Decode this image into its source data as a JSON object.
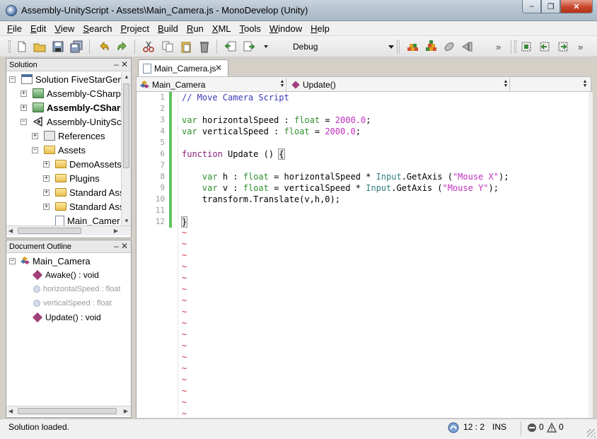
{
  "window": {
    "title": "Assembly-UnityScript - Assets\\Main_Camera.js - MonoDevelop (Unity)",
    "buttons": {
      "minimize": "‒",
      "maximize": "❐",
      "close": "✕"
    }
  },
  "menu": [
    {
      "key": "F",
      "rest": "ile"
    },
    {
      "key": "E",
      "rest": "dit"
    },
    {
      "key": "V",
      "rest": "iew"
    },
    {
      "key": "S",
      "rest": "earch"
    },
    {
      "key": "P",
      "rest": "roject"
    },
    {
      "key": "B",
      "rest": "uild"
    },
    {
      "key": "R",
      "rest": "un"
    },
    {
      "key": "X",
      "rest": "ML"
    },
    {
      "key": "T",
      "rest": "ools"
    },
    {
      "key": "W",
      "rest": "indow"
    },
    {
      "key": "H",
      "rest": "elp"
    }
  ],
  "toolbar": {
    "configuration": "Debug",
    "overflow": "»"
  },
  "solution_panel": {
    "title": "Solution",
    "controls": "‒ ✕",
    "items": [
      {
        "label": "Solution FiveStarGen",
        "icon": "solution-icon",
        "expander": "−",
        "bold": false
      },
      {
        "label": "Assembly-CSharp",
        "icon": "project-icon",
        "expander": "+",
        "bold": false
      },
      {
        "label": "Assembly-CSharp",
        "icon": "project-icon",
        "expander": "+",
        "bold": true
      },
      {
        "label": "Assembly-UnitySc",
        "icon": "unity-project-icon",
        "expander": "−",
        "bold": false
      },
      {
        "label": "References",
        "icon": "references-icon",
        "expander": "+",
        "bold": false
      },
      {
        "label": "Assets",
        "icon": "folder-icon",
        "expander": "−",
        "bold": false
      },
      {
        "label": "DemoAssets",
        "icon": "folder-icon",
        "expander": "+",
        "bold": false
      },
      {
        "label": "Plugins",
        "icon": "folder-icon",
        "expander": "+",
        "bold": false
      },
      {
        "label": "Standard Ass",
        "icon": "folder-icon",
        "expander": "+",
        "bold": false
      },
      {
        "label": "Standard Ass",
        "icon": "folder-icon",
        "expander": "+",
        "bold": false
      },
      {
        "label": "Main_Camer",
        "icon": "file-icon",
        "expander": "",
        "bold": false
      }
    ]
  },
  "outline_panel": {
    "title": "Document Outline",
    "controls": "‒ ✕",
    "root": "Main_Camera",
    "members": [
      {
        "label": "Awake() : void",
        "kind": "method",
        "dim": false
      },
      {
        "label": "horizontalSpeed : float",
        "kind": "field",
        "dim": true
      },
      {
        "label": "verticalSpeed : float",
        "kind": "field",
        "dim": true
      },
      {
        "label": "Update() : void",
        "kind": "method",
        "dim": false
      }
    ]
  },
  "editor": {
    "tab": "Main_Camera.js",
    "tab_close": "✕",
    "nav_class": "Main_Camera",
    "nav_member": "Update()",
    "line_numbers": [
      "1",
      "2",
      "3",
      "4",
      "5",
      "6",
      "7",
      "8",
      "9",
      "10",
      "11",
      "12"
    ],
    "tilde_count": 17,
    "tilde": "~"
  },
  "status": {
    "message": "Solution loaded.",
    "position": "12 : 2",
    "mode": "INS",
    "errors": "0",
    "warnings": "0"
  },
  "colors": {
    "accent": "#4a6fa0",
    "change_bar": "#5fc45f",
    "keyword": "#2f8f2f",
    "string": "#c030c0",
    "comment": "#3a3ab8"
  }
}
